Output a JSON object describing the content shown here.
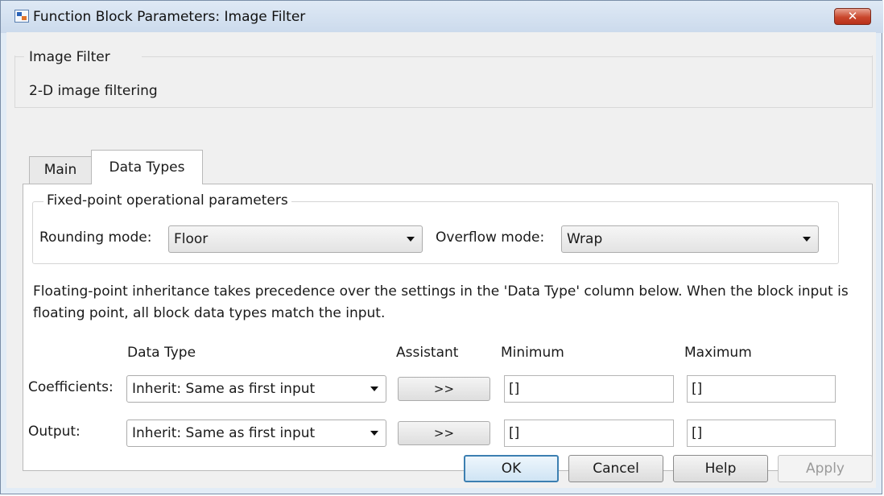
{
  "window": {
    "title": "Function Block Parameters: Image Filter",
    "close_label": "✕"
  },
  "description": {
    "title": "Image Filter",
    "text": "2-D image filtering"
  },
  "tabs": [
    {
      "label": "Main",
      "selected": false
    },
    {
      "label": "Data Types",
      "selected": true
    }
  ],
  "fixed_point": {
    "title": "Fixed-point operational parameters",
    "rounding_label": "Rounding mode:",
    "rounding_value": "Floor",
    "overflow_label": "Overflow mode:",
    "overflow_value": "Wrap"
  },
  "note": "Floating-point inheritance takes precedence over the settings in the 'Data Type' column below. When the block input is floating point, all block data types match the input.",
  "table": {
    "headers": {
      "data_type": "Data Type",
      "assistant": "Assistant",
      "minimum": "Minimum",
      "maximum": "Maximum"
    },
    "rows": [
      {
        "label": "Coefficients:",
        "data_type": "Inherit: Same as first input",
        "assistant": ">>",
        "minimum": "[]",
        "maximum": "[]"
      },
      {
        "label": "Output:",
        "data_type": "Inherit: Same as first input",
        "assistant": ">>",
        "minimum": "[]",
        "maximum": "[]"
      }
    ]
  },
  "buttons": {
    "ok": "OK",
    "cancel": "Cancel",
    "help": "Help",
    "apply": "Apply"
  },
  "colors": {
    "title_bar": "#cbdaec",
    "close_button": "#c9472c",
    "default_button_border": "#3c7fb1"
  }
}
